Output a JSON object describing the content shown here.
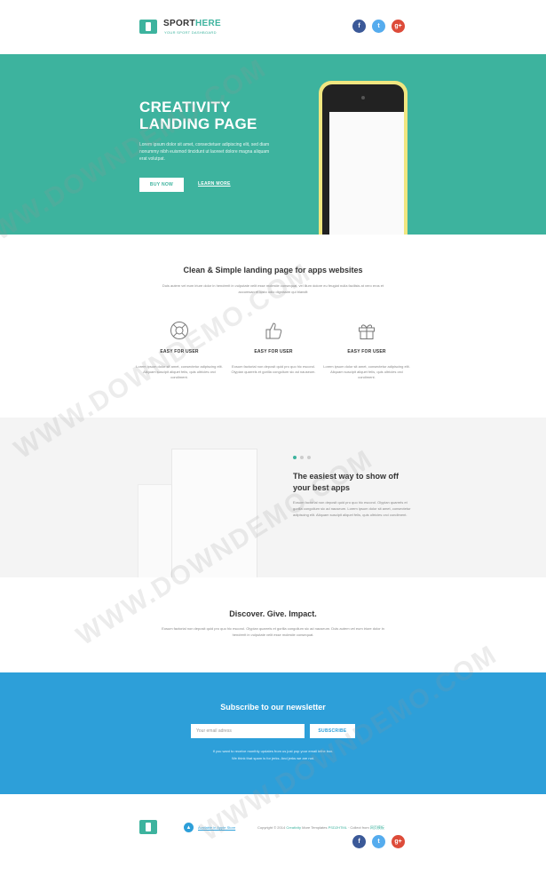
{
  "header": {
    "brand_bold": "SPORT",
    "brand_light": "HERE",
    "tagline": "YOUR SPORT DASHBOARD",
    "social": [
      "f",
      "t",
      "g+"
    ]
  },
  "hero": {
    "title_line1": "CREATIVITY",
    "title_line2": "LANDING PAGE",
    "text": "Lorem ipsum dolor sit amet, consectetuer adipiscing elit, sed diam nonummy nibh euismod tincidunt ut laoreet dolore magna aliquam erat volutpat.",
    "buy_label": "BUY NOW",
    "learn_label": "LEARN MORE",
    "accent": "#3db39e",
    "phone_color": "#f0e680"
  },
  "features": {
    "title": "Clean & Simple landing page for apps websites",
    "subtitle": "Duis autem vel eum iriure dolor in hendrerit in vulputate velit esse molestie consequat, vel illum dolore eu feugiat nulla facilisis at vero eros et accumsan et iusto odio dignissim qui blandit",
    "items": [
      {
        "icon": "lifebuoy-icon",
        "name": "EASY FOR USER",
        "desc": "Lorem ipsum dolor sit amet, consectetur adipiscing elit. Aliquam suscipit aliquet felis, quis ultricies orci condiment."
      },
      {
        "icon": "thumbs-up-icon",
        "name": "EASY FOR USER",
        "desc": "Eosum factorial non deposit quid pro quo hic escorol. Olypian quarrels et gorilla congolium sic ad nauseum."
      },
      {
        "icon": "gift-icon",
        "name": "EASY FOR USER",
        "desc": "Lorem ipsum dolor sit amet, consectetur adipiscing elit. Aliquam suscipit aliquet felis, quis ultricies orci condiment."
      }
    ]
  },
  "showcase": {
    "title": "The easiest way to show off your best apps",
    "text": "Eosum factorial non deposit quid pro quo hic escorol. Olypian quarrels et gorilla congolium sic ad nauseum. Lorem ipsum dolor sit amet, consectetur adipiscing elit. Aliquam suscipit aliquet felis, quis ultricies orci condiment.",
    "slides_total": 3,
    "slide_active": 1
  },
  "discover": {
    "title": "Discover. Give. Impact.",
    "text": "Eosum factorial non deposit quid pro quo hic escorol. Olypian quarrels et gorilla congolium sic ad nauseum. Duis autem vel eum iriure dolor in hendrerit in vulputate velit esse molestie consequat."
  },
  "newsletter": {
    "title": "Subscribe to our newsletter",
    "placeholder": "Your email adress",
    "button": "SUBSCRIBE",
    "note_line1": "If you want to receive monthly updates from us just pop your email inthe box.",
    "note_line2": "We think that spam is for jerks. And jerks we are not.",
    "bg": "#2d9fd9"
  },
  "footer": {
    "apple_label": "Available in Apple Store",
    "copyright": "Copyright © 2014",
    "copy_link": "Creativity",
    "copy_rest": "More Templates",
    "copy_tag": "PSD2HTML",
    "collect": "· Collect from",
    "collect_tag": "网页模板",
    "social": [
      "f",
      "t",
      "g+"
    ]
  },
  "watermark": "WWW.DOWNDEMO.COM"
}
